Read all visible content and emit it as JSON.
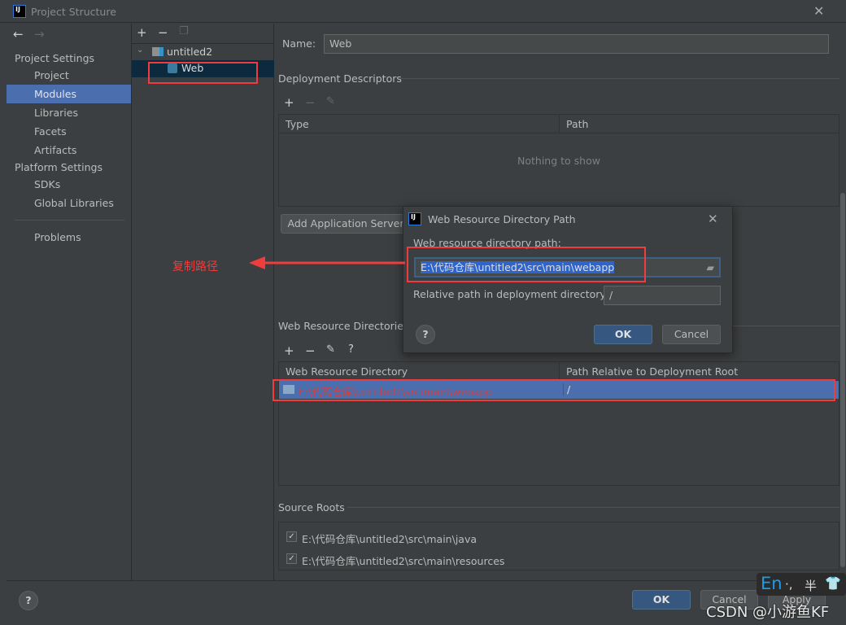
{
  "window": {
    "title": "Project Structure",
    "logo": "IJ"
  },
  "sidebar": {
    "project_settings": "Project Settings",
    "items": [
      {
        "label": "Project"
      },
      {
        "label": "Modules",
        "selected": true
      },
      {
        "label": "Libraries"
      },
      {
        "label": "Facets"
      },
      {
        "label": "Artifacts"
      }
    ],
    "platform_settings": "Platform Settings",
    "platform_items": [
      {
        "label": "SDKs"
      },
      {
        "label": "Global Libraries"
      }
    ],
    "problems": "Problems"
  },
  "tree": {
    "root": "untitled2",
    "child": "Web"
  },
  "main": {
    "name_label": "Name:",
    "name_value": "Web",
    "deployment_descriptors": "Deployment Descriptors",
    "dd_columns": [
      "Type",
      "Path"
    ],
    "dd_empty": "Nothing to show",
    "add_server_button": "Add Application Server",
    "web_resource_dirs": "Web Resource Directories",
    "wrd_columns": [
      "Web Resource Directory",
      "Path Relative to Deployment Root"
    ],
    "wrd_rows": [
      {
        "dir": "E:\\代码仓库\\untitled2\\src\\main\\webapp",
        "path": "/"
      }
    ],
    "source_roots": "Source Roots",
    "source_root_items": [
      {
        "label": "E:\\代码仓库\\untitled2\\src\\main\\java",
        "checked": true
      },
      {
        "label": "E:\\代码仓库\\untitled2\\src\\main\\resources",
        "checked": true
      }
    ]
  },
  "dialog": {
    "title": "Web Resource Directory Path",
    "path_label": "Web resource directory path:",
    "path_value": "E:\\代码仓库\\untitled2\\src\\main\\webapp",
    "relative_label": "Relative path in deployment directory:",
    "relative_value": "/",
    "ok": "OK",
    "cancel": "Cancel"
  },
  "annotation": {
    "text": "复制路径",
    "color": "#f03c3c"
  },
  "footer": {
    "ok": "OK",
    "cancel": "Cancel",
    "apply": "Apply"
  },
  "ime": {
    "lang": "En",
    "punct": "·,",
    "width": "半"
  },
  "watermark": "CSDN @小游鱼KF",
  "colors": {
    "selection": "#4b6eaf",
    "background": "#3c3f41",
    "annotation": "#f03c3c",
    "ok_button": "#365880"
  }
}
